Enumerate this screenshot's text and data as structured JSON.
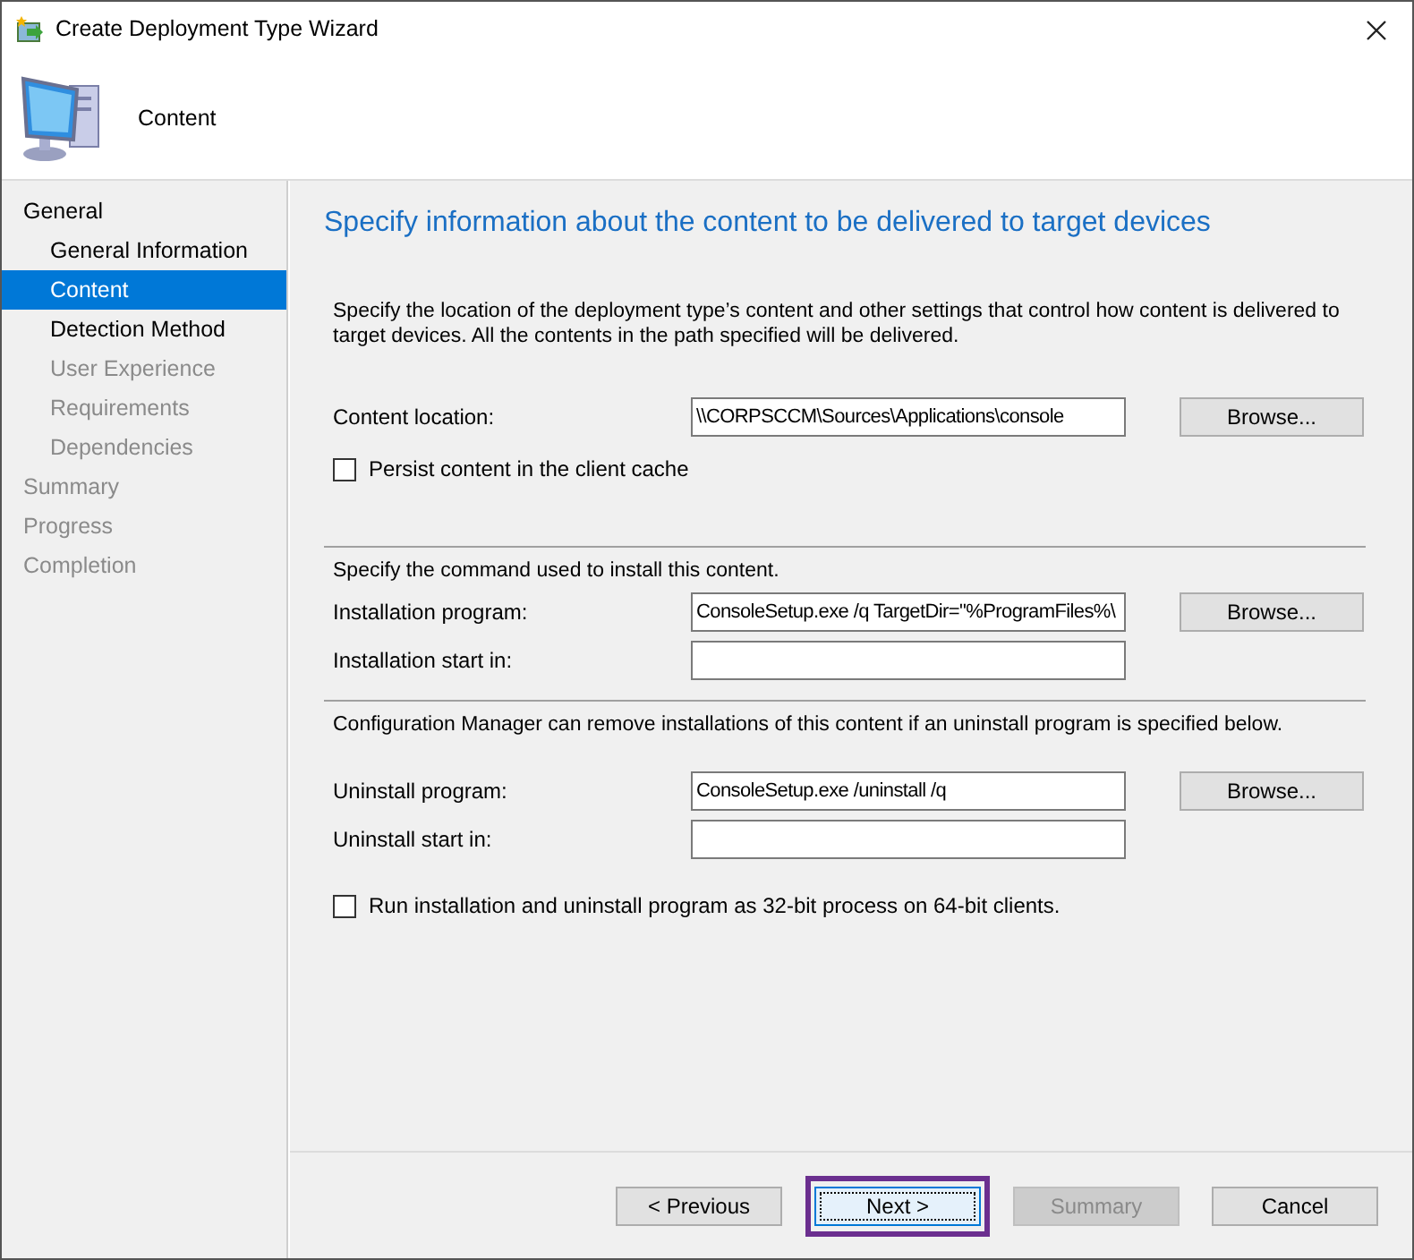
{
  "window": {
    "title": "Create Deployment Type Wizard"
  },
  "header": {
    "title": "Content"
  },
  "nav": [
    {
      "label": "General",
      "selected": false,
      "disabled": false,
      "children": [
        {
          "label": "General Information",
          "selected": false,
          "disabled": false
        },
        {
          "label": "Content",
          "selected": true,
          "disabled": false
        },
        {
          "label": "Detection Method",
          "selected": false,
          "disabled": false
        },
        {
          "label": "User Experience",
          "selected": false,
          "disabled": true
        },
        {
          "label": "Requirements",
          "selected": false,
          "disabled": true
        },
        {
          "label": "Dependencies",
          "selected": false,
          "disabled": true
        }
      ]
    },
    {
      "label": "Summary",
      "selected": false,
      "disabled": true
    },
    {
      "label": "Progress",
      "selected": false,
      "disabled": true
    },
    {
      "label": "Completion",
      "selected": false,
      "disabled": true
    }
  ],
  "page": {
    "heading": "Specify information about the content to be delivered to target devices",
    "sections": [
      {
        "intro": "Specify the location of the deployment type’s content and other settings that control how content is delivered to target devices. All the contents in the path specified will be delivered.",
        "fields": [
          {
            "label": "Content location:",
            "value": "\\\\CORPSCCM\\Sources\\Applications\\console",
            "button": "Browse..."
          }
        ],
        "checkbox": {
          "label": "Persist content in the client cache",
          "checked": false
        }
      },
      {
        "intro": "Specify the command used to install this content.",
        "fields": [
          {
            "label": "Installation program:",
            "value": "ConsoleSetup.exe /q TargetDir=\"%ProgramFiles%\\",
            "button": "Browse..."
          },
          {
            "label": "Installation start in:"
          }
        ]
      },
      {
        "intro": "Configuration Manager can remove installations of this content if an uninstall program is specified below.",
        "fields": [
          {
            "label": "Uninstall program:",
            "value": "ConsoleSetup.exe /uninstall /q",
            "button": "Browse..."
          },
          {
            "label": "Uninstall start in:"
          }
        ],
        "checkbox": {
          "label": "Run installation and uninstall program as 32-bit process on 64-bit clients.",
          "checked": false
        }
      }
    ]
  },
  "buttons": [
    {
      "label": "< Previous",
      "disabled": false,
      "highlighted": false
    },
    {
      "label": "Next >",
      "disabled": false,
      "highlighted": true
    },
    {
      "label": "Summary",
      "disabled": true,
      "highlighted": false
    },
    {
      "label": "Cancel",
      "disabled": false,
      "highlighted": false
    }
  ]
}
